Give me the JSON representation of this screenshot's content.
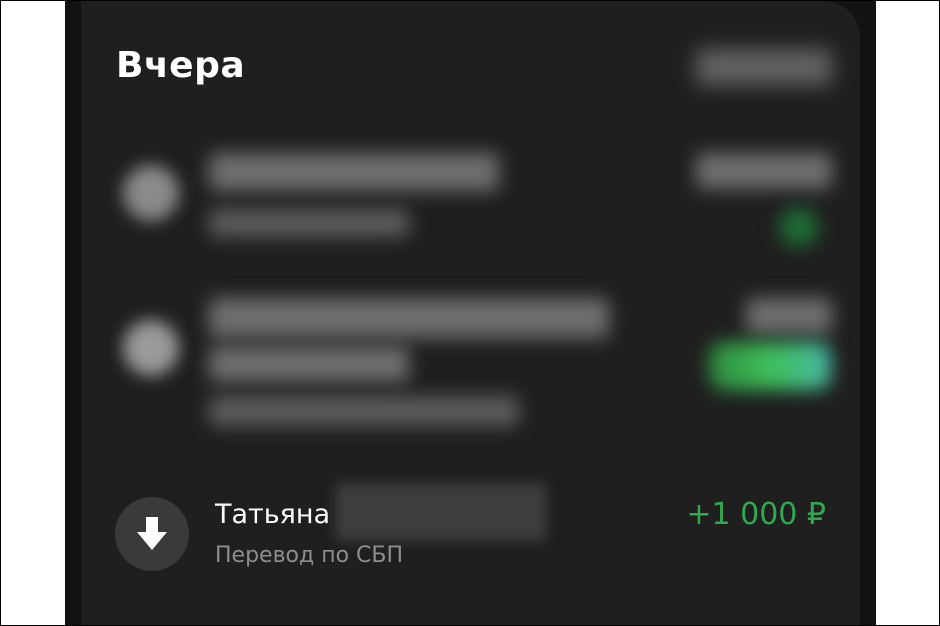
{
  "section": {
    "title": "Вчера"
  },
  "transaction": {
    "name": "Татьяна",
    "subtitle": "Перевод по СБП",
    "amount": "+1 000 ₽",
    "icon": "arrow-down-icon",
    "amount_color": "#2fa84f"
  },
  "colors": {
    "background": "#121212",
    "card": "#1f1f1f",
    "icon_circle": "#3a3a3a",
    "subtitle": "#8e8e8e",
    "positive_amount": "#2fa84f"
  }
}
